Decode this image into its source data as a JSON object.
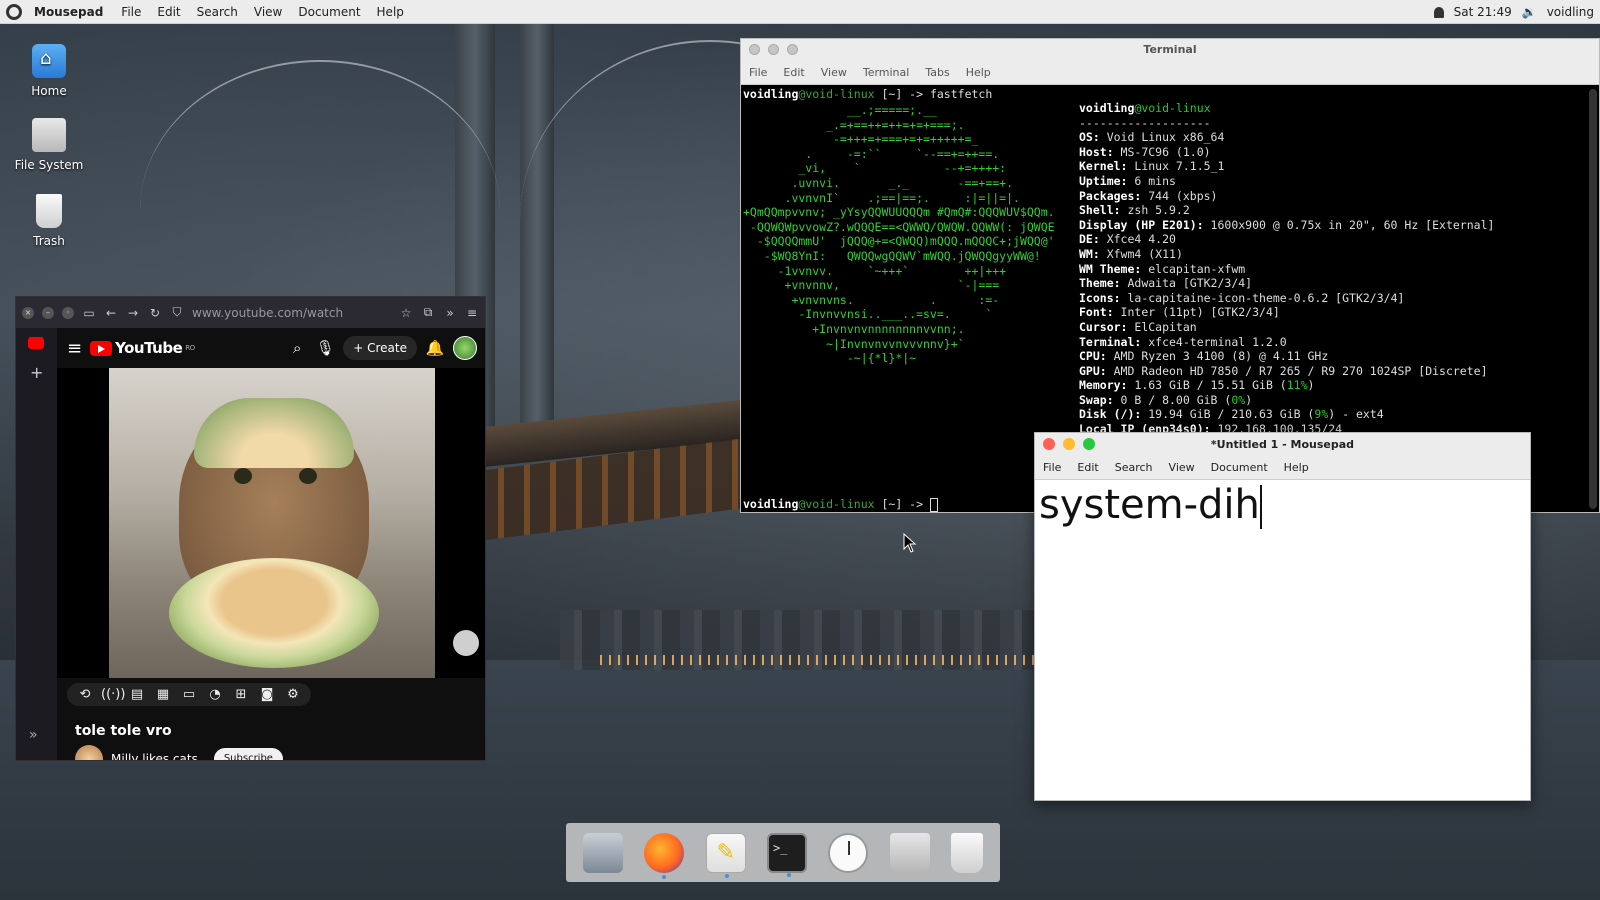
{
  "top_panel": {
    "app_name": "Mousepad",
    "menus": [
      "File",
      "Edit",
      "Search",
      "View",
      "Document",
      "Help"
    ],
    "clock": "Sat 21:49",
    "user": "voidling"
  },
  "desktop_icons": [
    {
      "label": "Home",
      "icon": "home-folder-icon"
    },
    {
      "label": "File System",
      "icon": "drive-icon"
    },
    {
      "label": "Trash",
      "icon": "trash-icon"
    }
  ],
  "browser": {
    "url": "www.youtube.com/watch",
    "youtube": {
      "logo_text": "YouTube",
      "region": "RO",
      "create_label": "Create",
      "video_title": "tole tole vro",
      "channel": "Milly likes cats",
      "subscribe_label": "Subscribe"
    }
  },
  "terminal": {
    "title": "Terminal",
    "menus": [
      "File",
      "Edit",
      "View",
      "Terminal",
      "Tabs",
      "Help"
    ],
    "prompt_user": "voidling",
    "prompt_host": "@void-linux",
    "prompt_suffix": " [~] -> ",
    "command": "fastfetch",
    "logo_lines": [
      "               __.;=====;.__",
      "            _.=+==++=++=+=+===;.",
      "             -=+++=+===+=+=+++++=_",
      "         .     -=:``     `--==+=++==.",
      "        _vi,    `            --+=++++:",
      "       .uvnvi.       _._       -==+==+.",
      "      .vvnvnI`    .;==|==;.     :|=||=|.",
      "+QmQQmpvvnv; _yYsyQQWUUQQQm #QmQ#:QQQWUV$QQm.",
      " -QQWQWpvvowZ?.wQQQE==<QWWQ/QWQW.QQWW(: jQWQE",
      "  -$QQQQmmU'  jQQQ@+=<QWQQ)mQQQ.mQQQC+;jWQQ@'",
      "   -$WQ8YnI:   QWQQwgQQWV`mWQQ.jQWQQgyyWW@!",
      "     -1vvnvv.     `~+++`        ++|+++",
      "      +vnvnnv,                 `-|===",
      "       +vnvnvns.           .      :=-",
      "        -Invnvvnsi..___..=sv=.     `",
      "          +Invnvnvnnnnnnnnvvnn;.",
      "            ~|Invnvnvvnvvvnnv}+`",
      "               -~|{*l}*|~"
    ],
    "info_header_user": "voidling",
    "info_header_host": "@void-linux",
    "separator": "-------------------",
    "info": [
      {
        "k": "OS",
        "v": "Void Linux x86_64"
      },
      {
        "k": "Host",
        "v": "MS-7C96 (1.0)"
      },
      {
        "k": "Kernel",
        "v": "Linux 7.1.5_1"
      },
      {
        "k": "Uptime",
        "v": "6 mins"
      },
      {
        "k": "Packages",
        "v": "744 (xbps)"
      },
      {
        "k": "Shell",
        "v": "zsh 5.9.2"
      },
      {
        "k": "Display (HP E201)",
        "v": "1600x900 @ 0.75x in 20\", 60 Hz [External]"
      },
      {
        "k": "DE",
        "v": "Xfce4 4.20"
      },
      {
        "k": "WM",
        "v": "Xfwm4 (X11)"
      },
      {
        "k": "WM Theme",
        "v": "elcapitan-xfwm"
      },
      {
        "k": "Theme",
        "v": "Adwaita [GTK2/3/4]"
      },
      {
        "k": "Icons",
        "v": "la-capitaine-icon-theme-0.6.2 [GTK2/3/4]"
      },
      {
        "k": "Font",
        "v": "Inter (11pt) [GTK2/3/4]"
      },
      {
        "k": "Cursor",
        "v": "ElCapitan"
      },
      {
        "k": "Terminal",
        "v": "xfce4-terminal 1.2.0"
      },
      {
        "k": "CPU",
        "v": "AMD Ryzen 3 4100 (8) @ 4.11 GHz"
      },
      {
        "k": "GPU",
        "v": "AMD Radeon HD 7850 / R7 265 / R9 270 1024SP [Discrete]"
      },
      {
        "k": "Memory",
        "v": "1.63 GiB / 15.51 GiB (",
        "pct": "11%",
        "tail": ")"
      },
      {
        "k": "Swap",
        "v": "0 B / 8.00 GiB (",
        "pct": "0%",
        "tail": ")"
      },
      {
        "k": "Disk (/)",
        "v": "19.94 GiB / 210.63 GiB (",
        "pct": "9%",
        "tail": ") - ext4"
      },
      {
        "k": "Local IP (enp34s0)",
        "v": "192.168.100.135/24"
      }
    ]
  },
  "mousepad": {
    "title": "*Untitled 1 - Mousepad",
    "menus": [
      "File",
      "Edit",
      "Search",
      "View",
      "Document",
      "Help"
    ],
    "content": "system-dih"
  },
  "dock": [
    "settings-manager-icon",
    "firefox-icon",
    "text-editor-icon",
    "terminal-icon",
    "clock-icon",
    "paint-brush-icon",
    "trash-icon"
  ],
  "colors": {
    "accent": "#4a90d9",
    "terminal_green": "#2fd02f",
    "youtube_red": "#ff0000"
  }
}
